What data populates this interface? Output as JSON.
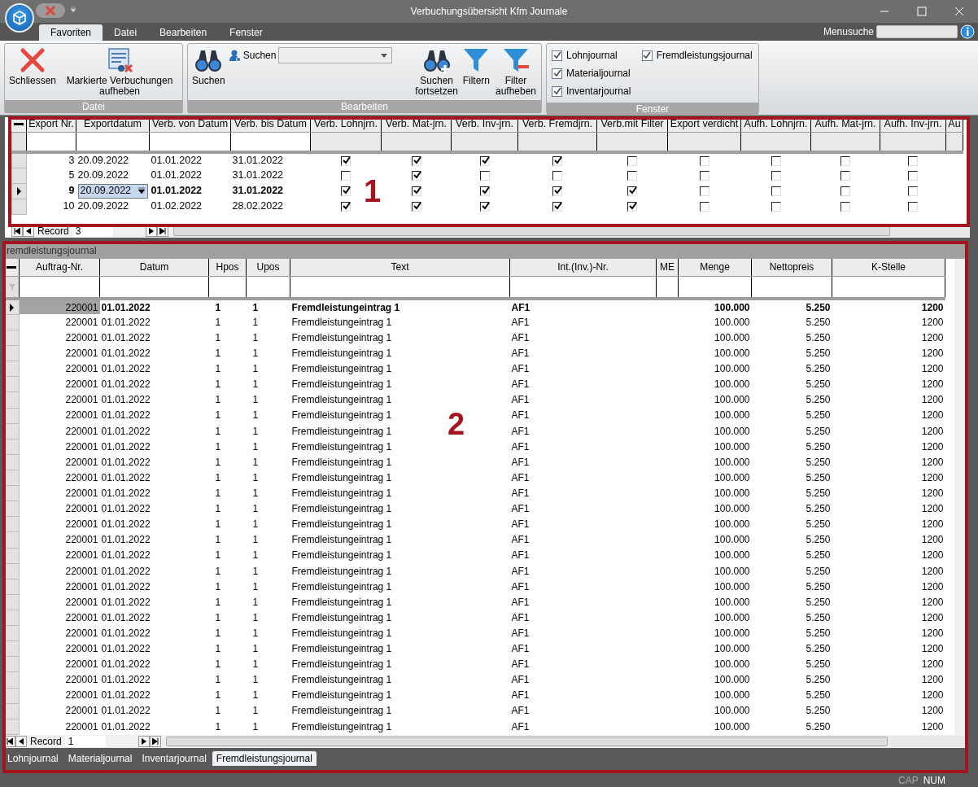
{
  "window": {
    "title": "Verbuchungsübersicht Kfm Journale"
  },
  "ribbon_tabs": [
    {
      "label": "Favoriten",
      "selected": true
    },
    {
      "label": "Datei",
      "selected": false
    },
    {
      "label": "Bearbeiten",
      "selected": false
    },
    {
      "label": "Fenster",
      "selected": false
    }
  ],
  "menu_search": {
    "label": "Menusuche"
  },
  "ribbon_groups": [
    {
      "title": "Datei",
      "items": [
        {
          "kind": "close",
          "label": "Schliessen"
        },
        {
          "kind": "unmark",
          "label": "Markierte Verbuchungen aufheben"
        }
      ]
    },
    {
      "title": "Bearbeiten",
      "items": [
        {
          "kind": "search",
          "label": "Suchen"
        },
        {
          "kind": "combo",
          "label": "Suchen"
        },
        {
          "kind": "continue",
          "label": "Suchen fortsetzen"
        },
        {
          "kind": "filter",
          "label": "Filtern"
        },
        {
          "kind": "unfilter",
          "label": "Filter aufheben"
        }
      ]
    },
    {
      "title": "Fenster",
      "items": [
        {
          "kind": "check",
          "label": "Lohnjournal",
          "checked": true
        },
        {
          "kind": "check",
          "label": "Materialjournal",
          "checked": true
        },
        {
          "kind": "check",
          "label": "Inventarjournal",
          "checked": true
        },
        {
          "kind": "check",
          "label": "Fremdleistungsjournal",
          "checked": true
        }
      ]
    }
  ],
  "upper_grid": {
    "columns": [
      "Export Nr.",
      "Exportdatum",
      "Verb. von Datum",
      "Verb. bis Datum",
      "Verb. Lohnjrn.",
      "Verb. Mat-jrn.",
      "Verb. Inv-jrn.",
      "Verb. Fremdjrn.",
      "Verb.mit Filter",
      "Export verdicht",
      "Aufh. Lohnjrn.",
      "Aufh. Mat-jrn.",
      "Aufh. Inv-jrn.",
      "Au"
    ],
    "rows": [
      {
        "export_nr": "3",
        "exportdatum": "20.09.2022",
        "von": "01.01.2022",
        "bis": "31.01.2022",
        "checks": [
          true,
          true,
          true,
          true,
          false,
          false,
          false,
          false,
          false
        ],
        "selected": false
      },
      {
        "export_nr": "5",
        "exportdatum": "20.09.2022",
        "von": "01.01.2022",
        "bis": "31.01.2022",
        "checks": [
          false,
          true,
          false,
          false,
          false,
          false,
          false,
          false,
          false
        ],
        "selected": false
      },
      {
        "export_nr": "9",
        "exportdatum": "20.09.2022",
        "von": "01.01.2022",
        "bis": "31.01.2022",
        "checks": [
          true,
          true,
          true,
          true,
          true,
          false,
          false,
          false,
          false
        ],
        "selected": true
      },
      {
        "export_nr": "10",
        "exportdatum": "20.09.2022",
        "von": "01.02.2022",
        "bis": "28.02.2022",
        "checks": [
          true,
          true,
          true,
          true,
          true,
          false,
          false,
          false,
          false
        ],
        "selected": false
      }
    ],
    "navigator": {
      "label": "Record",
      "value": "3"
    }
  },
  "panel": {
    "title": "remdleistungsjournal"
  },
  "lower_grid": {
    "columns": [
      "Auftrag-Nr.",
      "Datum",
      "Hpos",
      "Upos",
      "Text",
      "Int.(Inv.)-Nr.",
      "ME",
      "Menge",
      "Nettopreis",
      "K-Stelle"
    ],
    "rows": [
      {
        "auftrag": "220001",
        "datum": "01.01.2022",
        "hpos": "1",
        "upos": "1",
        "text": "Fremdleistungeintrag 1",
        "int": "AF1",
        "menge": "100.000",
        "nettopreis": "5.250",
        "kstelle": "1200",
        "selected": true
      },
      {
        "auftrag": "220001",
        "datum": "01.01.2022",
        "hpos": "1",
        "upos": "1",
        "text": "Fremdleistungeintrag 1",
        "int": "AF1",
        "menge": "100.000",
        "nettopreis": "5.250",
        "kstelle": "1200",
        "selected": false
      },
      {
        "auftrag": "220001",
        "datum": "01.01.2022",
        "hpos": "1",
        "upos": "1",
        "text": "Fremdleistungeintrag 1",
        "int": "AF1",
        "menge": "100.000",
        "nettopreis": "5.250",
        "kstelle": "1200",
        "selected": false
      },
      {
        "auftrag": "220001",
        "datum": "01.01.2022",
        "hpos": "1",
        "upos": "1",
        "text": "Fremdleistungeintrag 1",
        "int": "AF1",
        "menge": "100.000",
        "nettopreis": "5.250",
        "kstelle": "1200",
        "selected": false
      },
      {
        "auftrag": "220001",
        "datum": "01.01.2022",
        "hpos": "1",
        "upos": "1",
        "text": "Fremdleistungeintrag 1",
        "int": "AF1",
        "menge": "100.000",
        "nettopreis": "5.250",
        "kstelle": "1200",
        "selected": false
      },
      {
        "auftrag": "220001",
        "datum": "01.01.2022",
        "hpos": "1",
        "upos": "1",
        "text": "Fremdleistungeintrag 1",
        "int": "AF1",
        "menge": "100.000",
        "nettopreis": "5.250",
        "kstelle": "1200",
        "selected": false
      },
      {
        "auftrag": "220001",
        "datum": "01.01.2022",
        "hpos": "1",
        "upos": "1",
        "text": "Fremdleistungeintrag 1",
        "int": "AF1",
        "menge": "100.000",
        "nettopreis": "5.250",
        "kstelle": "1200",
        "selected": false
      },
      {
        "auftrag": "220001",
        "datum": "01.01.2022",
        "hpos": "1",
        "upos": "1",
        "text": "Fremdleistungeintrag 1",
        "int": "AF1",
        "menge": "100.000",
        "nettopreis": "5.250",
        "kstelle": "1200",
        "selected": false
      },
      {
        "auftrag": "220001",
        "datum": "01.01.2022",
        "hpos": "1",
        "upos": "1",
        "text": "Fremdleistungeintrag 1",
        "int": "AF1",
        "menge": "100.000",
        "nettopreis": "5.250",
        "kstelle": "1200",
        "selected": false
      },
      {
        "auftrag": "220001",
        "datum": "01.01.2022",
        "hpos": "1",
        "upos": "1",
        "text": "Fremdleistungeintrag 1",
        "int": "AF1",
        "menge": "100.000",
        "nettopreis": "5.250",
        "kstelle": "1200",
        "selected": false
      },
      {
        "auftrag": "220001",
        "datum": "01.01.2022",
        "hpos": "1",
        "upos": "1",
        "text": "Fremdleistungeintrag 1",
        "int": "AF1",
        "menge": "100.000",
        "nettopreis": "5.250",
        "kstelle": "1200",
        "selected": false
      },
      {
        "auftrag": "220001",
        "datum": "01.01.2022",
        "hpos": "1",
        "upos": "1",
        "text": "Fremdleistungeintrag 1",
        "int": "AF1",
        "menge": "100.000",
        "nettopreis": "5.250",
        "kstelle": "1200",
        "selected": false
      },
      {
        "auftrag": "220001",
        "datum": "01.01.2022",
        "hpos": "1",
        "upos": "1",
        "text": "Fremdleistungeintrag 1",
        "int": "AF1",
        "menge": "100.000",
        "nettopreis": "5.250",
        "kstelle": "1200",
        "selected": false
      },
      {
        "auftrag": "220001",
        "datum": "01.01.2022",
        "hpos": "1",
        "upos": "1",
        "text": "Fremdleistungeintrag 1",
        "int": "AF1",
        "menge": "100.000",
        "nettopreis": "5.250",
        "kstelle": "1200",
        "selected": false
      },
      {
        "auftrag": "220001",
        "datum": "01.01.2022",
        "hpos": "1",
        "upos": "1",
        "text": "Fremdleistungeintrag 1",
        "int": "AF1",
        "menge": "100.000",
        "nettopreis": "5.250",
        "kstelle": "1200",
        "selected": false
      },
      {
        "auftrag": "220001",
        "datum": "01.01.2022",
        "hpos": "1",
        "upos": "1",
        "text": "Fremdleistungeintrag 1",
        "int": "AF1",
        "menge": "100.000",
        "nettopreis": "5.250",
        "kstelle": "1200",
        "selected": false
      },
      {
        "auftrag": "220001",
        "datum": "01.01.2022",
        "hpos": "1",
        "upos": "1",
        "text": "Fremdleistungeintrag 1",
        "int": "AF1",
        "menge": "100.000",
        "nettopreis": "5.250",
        "kstelle": "1200",
        "selected": false
      },
      {
        "auftrag": "220001",
        "datum": "01.01.2022",
        "hpos": "1",
        "upos": "1",
        "text": "Fremdleistungeintrag 1",
        "int": "AF1",
        "menge": "100.000",
        "nettopreis": "5.250",
        "kstelle": "1200",
        "selected": false
      },
      {
        "auftrag": "220001",
        "datum": "01.01.2022",
        "hpos": "1",
        "upos": "1",
        "text": "Fremdleistungeintrag 1",
        "int": "AF1",
        "menge": "100.000",
        "nettopreis": "5.250",
        "kstelle": "1200",
        "selected": false
      },
      {
        "auftrag": "220001",
        "datum": "01.01.2022",
        "hpos": "1",
        "upos": "1",
        "text": "Fremdleistungeintrag 1",
        "int": "AF1",
        "menge": "100.000",
        "nettopreis": "5.250",
        "kstelle": "1200",
        "selected": false
      },
      {
        "auftrag": "220001",
        "datum": "01.01.2022",
        "hpos": "1",
        "upos": "1",
        "text": "Fremdleistungeintrag 1",
        "int": "AF1",
        "menge": "100.000",
        "nettopreis": "5.250",
        "kstelle": "1200",
        "selected": false
      },
      {
        "auftrag": "220001",
        "datum": "01.01.2022",
        "hpos": "1",
        "upos": "1",
        "text": "Fremdleistungeintrag 1",
        "int": "AF1",
        "menge": "100.000",
        "nettopreis": "5.250",
        "kstelle": "1200",
        "selected": false
      },
      {
        "auftrag": "220001",
        "datum": "01.01.2022",
        "hpos": "1",
        "upos": "1",
        "text": "Fremdleistungeintrag 1",
        "int": "AF1",
        "menge": "100.000",
        "nettopreis": "5.250",
        "kstelle": "1200",
        "selected": false
      },
      {
        "auftrag": "220001",
        "datum": "01.01.2022",
        "hpos": "1",
        "upos": "1",
        "text": "Fremdleistungeintrag 1",
        "int": "AF1",
        "menge": "100.000",
        "nettopreis": "5.250",
        "kstelle": "1200",
        "selected": false
      },
      {
        "auftrag": "220001",
        "datum": "01.01.2022",
        "hpos": "1",
        "upos": "1",
        "text": "Fremdleistungeintrag 1",
        "int": "AF1",
        "menge": "100.000",
        "nettopreis": "5.250",
        "kstelle": "1200",
        "selected": false
      },
      {
        "auftrag": "220001",
        "datum": "01.01.2022",
        "hpos": "1",
        "upos": "1",
        "text": "Fremdleistungeintrag 1",
        "int": "AF1",
        "menge": "100.000",
        "nettopreis": "5.250",
        "kstelle": "1200",
        "selected": false
      },
      {
        "auftrag": "220001",
        "datum": "01.01.2022",
        "hpos": "1",
        "upos": "1",
        "text": "Fremdleistungeintrag 1",
        "int": "AF1",
        "menge": "100.000",
        "nettopreis": "5.250",
        "kstelle": "1200",
        "selected": false
      },
      {
        "auftrag": "220001",
        "datum": "01.01.2022",
        "hpos": "1",
        "upos": "1",
        "text": "Fremdleistungeintrag 1",
        "int": "AF1",
        "menge": "100.000",
        "nettopreis": "5.250",
        "kstelle": "1200",
        "selected": false
      }
    ],
    "navigator": {
      "label": "Record",
      "value": "1"
    }
  },
  "journal_tabs": [
    {
      "label": "Lohnjournal",
      "selected": false
    },
    {
      "label": "Materialjournal",
      "selected": false
    },
    {
      "label": "Inventarjournal",
      "selected": false
    },
    {
      "label": "Fremdleistungsjournal",
      "selected": true
    }
  ],
  "status_bar": [
    {
      "label": "CAP",
      "on": false
    },
    {
      "label": "NUM",
      "on": true
    }
  ],
  "annotations": [
    {
      "label": "1"
    },
    {
      "label": "2"
    }
  ]
}
